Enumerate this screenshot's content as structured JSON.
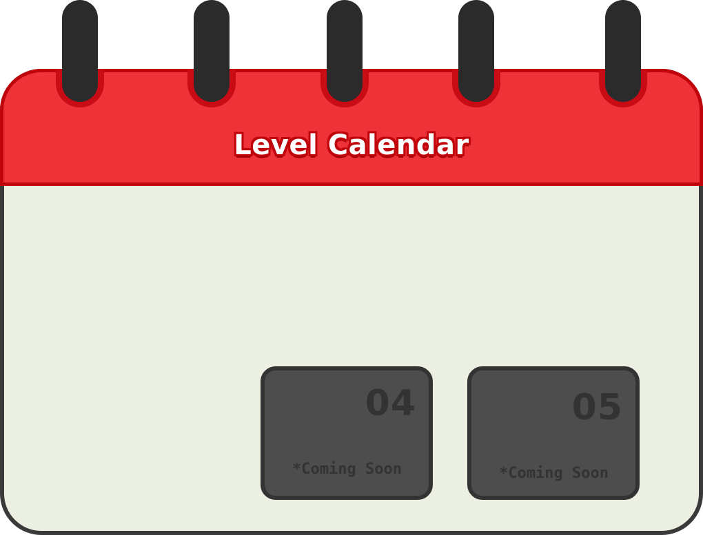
{
  "header": {
    "title": "Level Calendar"
  },
  "colors": {
    "header_red": "#ee3338",
    "header_border": "#c0040c",
    "page_background": "#ecf0e2",
    "outline": "#3a3a3a",
    "ring": "#2b2b2b",
    "card_fill": "#4d4d4d",
    "card_text": "#333333"
  },
  "levels": [
    {
      "number": "04",
      "note": "*Coming Soon",
      "locked": true
    },
    {
      "number": "05",
      "note": "*Coming Soon",
      "locked": true
    }
  ]
}
